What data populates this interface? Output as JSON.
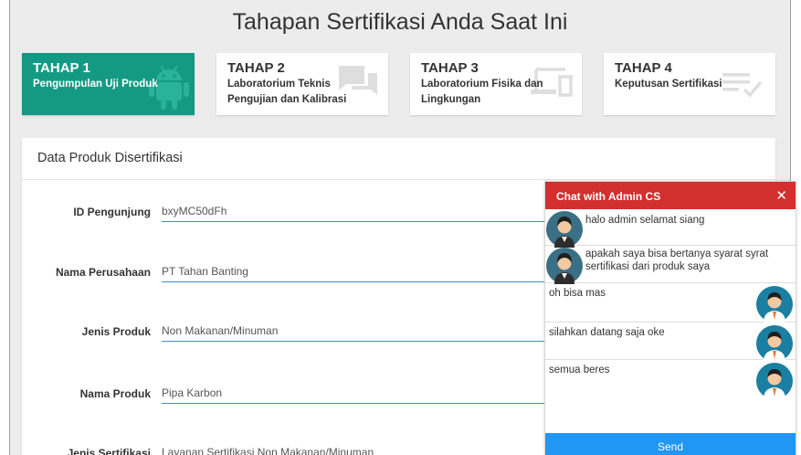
{
  "page_title": "Tahapan Sertifikasi Anda Saat Ini",
  "steps": [
    {
      "title": "TAHAP 1",
      "subtitle_line1": "Pengumpulan Uji Produk",
      "subtitle_line2": "",
      "icon": "android-icon",
      "active": true
    },
    {
      "title": "TAHAP 2",
      "subtitle_line1": "Laboratorium Teknis",
      "subtitle_line2": "Pengujian dan Kalibrasi",
      "icon": "chat-bubbles-icon",
      "active": false
    },
    {
      "title": "TAHAP 3",
      "subtitle_line1": "Laboratorium Fisika dan",
      "subtitle_line2": "Lingkungan",
      "icon": "devices-icon",
      "active": false
    },
    {
      "title": "TAHAP 4",
      "subtitle_line1": "Keputusan Sertifikasi",
      "subtitle_line2": "",
      "icon": "checklist-icon",
      "active": false
    }
  ],
  "panel": {
    "title": "Data Produk Disertifikasi",
    "fields": [
      {
        "label": "ID Pengunjung",
        "value": "bxyMC50dFh"
      },
      {
        "label": "Nama Perusahaan",
        "value": "PT Tahan Banting"
      },
      {
        "label": "Jenis Produk",
        "value": "Non Makanan/Minuman"
      },
      {
        "label": "Nama Produk",
        "value": "Pipa Karbon"
      },
      {
        "label": "Jenis Sertifikasi",
        "value": "Layanan Sertifikasi Non Makanan/Minuman"
      }
    ]
  },
  "chat": {
    "title": "Chat with Admin CS",
    "close_icon": "close-icon",
    "messages": [
      {
        "side": "left",
        "sender": "user",
        "text": "halo admin selamat siang"
      },
      {
        "side": "left",
        "sender": "user",
        "text": "apakah saya bisa bertanya syarat syrat sertifikasi dari produk saya"
      },
      {
        "side": "right",
        "sender": "admin",
        "text": "oh bisa mas"
      },
      {
        "side": "right",
        "sender": "admin",
        "text": "silahkan datang saja oke"
      },
      {
        "side": "right",
        "sender": "admin",
        "text": "semua beres"
      }
    ],
    "send_label": "Send"
  },
  "colors": {
    "accent_green": "#149a84",
    "chat_header_red": "#d32f2f",
    "send_blue": "#2196f3",
    "input_underline_blue": "#3d8fd1",
    "background": "#ececec"
  }
}
